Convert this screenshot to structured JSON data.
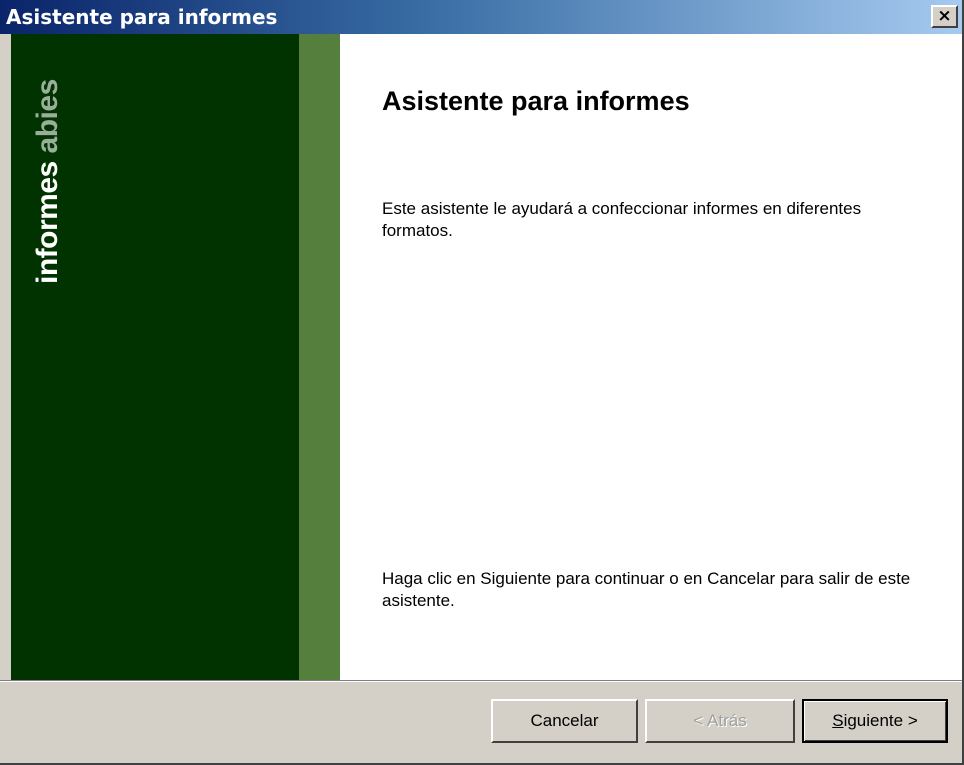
{
  "window": {
    "title": "Asistente para informes",
    "close_label": "×"
  },
  "sidebar": {
    "logo_main": "informes",
    "logo_accent": "abies",
    "colors": {
      "panel": "#003300",
      "stripe": "#557f3d"
    }
  },
  "main": {
    "heading": "Asistente para informes",
    "intro": "Este asistente le ayudará a confeccionar informes en diferentes formatos.",
    "instruction": "Haga clic en Siguiente para continuar o en Cancelar para salir de este asistente."
  },
  "footer": {
    "cancel_label": "Cancelar",
    "back_label": "< Atrás",
    "next_label_underlined": "S",
    "next_label_rest": "iguiente >"
  }
}
